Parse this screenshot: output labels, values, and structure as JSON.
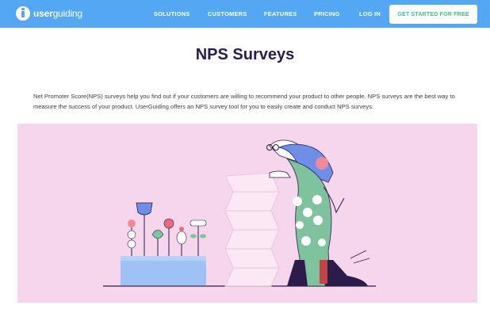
{
  "brand": {
    "name_prefix": "user",
    "name_suffix": "guiding"
  },
  "nav": {
    "items": [
      "SOLUTIONS",
      "CUSTOMERS",
      "FEATURES",
      "PRICING",
      "LOG IN"
    ],
    "cta_label": "GET STARTED FOR FREE"
  },
  "page": {
    "title": "NPS Surveys",
    "description": "Net Promoter Score(NPS) surveys help you find out if your customers are willing to recommend your product to other people. NPS surveys are the best way to measure the success of your product. UserGuiding offers an NPS survey tool for you to easily create and conduct NPS surveys."
  },
  "colors": {
    "header_bg": "#54a7f2",
    "cta_text": "#3fbf86",
    "title": "#2b1c4b",
    "hero_bg": "#f5d6ec",
    "planter": "#9fc2f4"
  },
  "hero": {
    "illustration": "person-with-survey-form-and-flower-planter"
  }
}
